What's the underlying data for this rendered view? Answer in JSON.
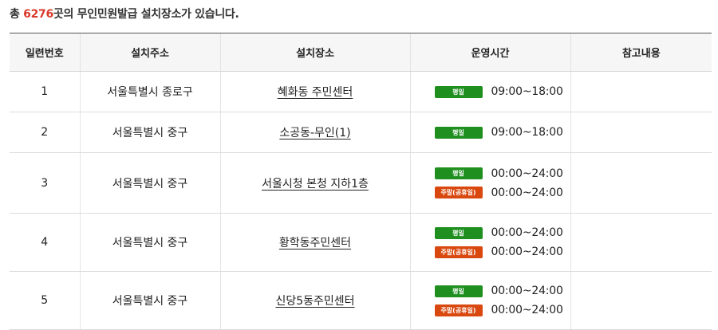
{
  "summary": {
    "prefix": "총 ",
    "count": "6276",
    "suffix": "곳의 무인민원발급 설치장소가 있습니다."
  },
  "table": {
    "headers": [
      "일련번호",
      "설치주소",
      "설치장소",
      "운영시간",
      "참고내용"
    ],
    "rows": [
      {
        "no": "1",
        "address": "서울특별시 종로구",
        "place": "혜화동 주민센터",
        "hours": [
          {
            "badge": "평일",
            "time": "09:00~18:00"
          }
        ],
        "note": ""
      },
      {
        "no": "2",
        "address": "서울특별시 중구",
        "place": "소공동-무인(1)",
        "hours": [
          {
            "badge": "평일",
            "time": "09:00~18:00"
          }
        ],
        "note": ""
      },
      {
        "no": "3",
        "address": "서울특별시 중구",
        "place": "서울시청 본청 지하1층",
        "hours": [
          {
            "badge": "평일",
            "time": "00:00~24:00"
          },
          {
            "badge": "주말(공휴일)",
            "time": "00:00~24:00"
          }
        ],
        "note": ""
      },
      {
        "no": "4",
        "address": "서울특별시 중구",
        "place": "황학동주민센터",
        "hours": [
          {
            "badge": "평일",
            "time": "00:00~24:00"
          },
          {
            "badge": "주말(공휴일)",
            "time": "00:00~24:00"
          }
        ],
        "note": ""
      },
      {
        "no": "5",
        "address": "서울특별시 중구",
        "place": "신당5동주민센터",
        "hours": [
          {
            "badge": "평일",
            "time": "00:00~24:00"
          },
          {
            "badge": "주말(공휴일)",
            "time": "00:00~24:00"
          }
        ],
        "note": ""
      }
    ]
  },
  "colors": {
    "count": "#d93a2b",
    "weekday_badge": "#1f8f1f",
    "weekend_badge": "#d9480f"
  }
}
